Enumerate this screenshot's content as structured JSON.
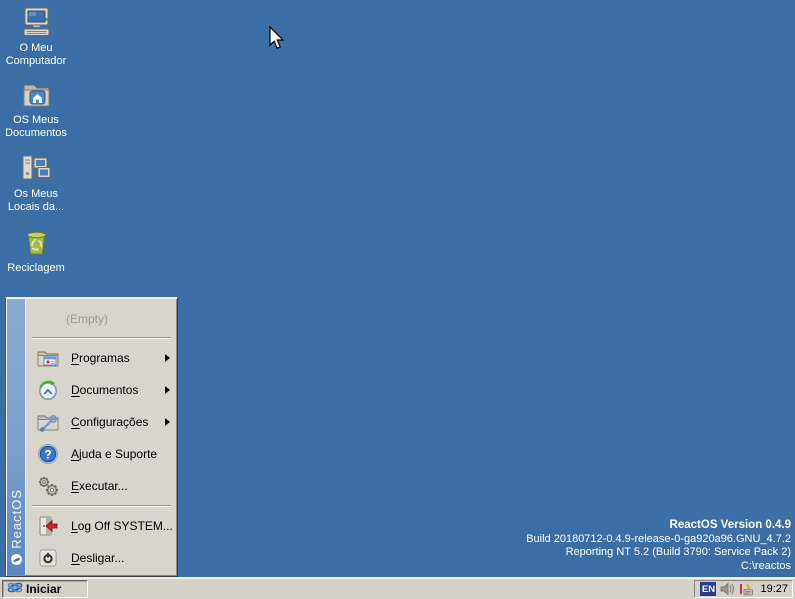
{
  "desktop": {
    "background_color": "#3B6EA5",
    "icons": [
      {
        "id": "my-computer",
        "lines": [
          "O Meu",
          "Computador"
        ]
      },
      {
        "id": "my-documents",
        "lines": [
          "OS Meus",
          "Documentos"
        ]
      },
      {
        "id": "network-places",
        "lines": [
          "Os Meus",
          "Locais da..."
        ]
      },
      {
        "id": "recycle-bin",
        "lines": [
          "Reciclagem"
        ]
      }
    ]
  },
  "start_menu": {
    "sidebar_text": "ReactOS",
    "empty_label": "(Empty)",
    "items": [
      {
        "id": "programas",
        "label": "Programas",
        "label_u": "P",
        "label_rest": "rogramas",
        "has_submenu": true
      },
      {
        "id": "documentos",
        "label": "Documentos",
        "label_u": "D",
        "label_rest": "ocumentos",
        "has_submenu": true
      },
      {
        "id": "configuracoes",
        "label": "Configurações",
        "label_u": "C",
        "label_rest": "onfigurações",
        "has_submenu": true
      },
      {
        "id": "ajuda",
        "label": "Ajuda e Suporte",
        "label_u": "A",
        "label_rest": "juda e Suporte",
        "has_submenu": false
      },
      {
        "id": "executar",
        "label": "Executar...",
        "label_u": "E",
        "label_rest": "xecutar...",
        "has_submenu": false
      },
      {
        "id": "logoff",
        "label": "Log Off SYSTEM...",
        "label_u": "L",
        "label_rest": "og Off SYSTEM...",
        "has_submenu": false
      },
      {
        "id": "desligar",
        "label": "Desligar...",
        "label_u": "D",
        "label_rest": "esligar...",
        "has_submenu": false
      }
    ]
  },
  "version_info": {
    "lines": [
      "ReactOS Version 0.4.9",
      "Build 20180712-0.4.9-release-0-ga920a96.GNU_4.7.2",
      "Reporting NT 5.2 (Build 3790: Service Pack 2)",
      "C:\\reactos"
    ]
  },
  "taskbar": {
    "start_label": "Iniciar",
    "tray": {
      "language_indicator": "EN",
      "clock": "19:27"
    }
  },
  "colors": {
    "desktop": "#3B6EA5",
    "menu_face": "#D8D5CD",
    "taskbar": "#D4D1C9",
    "sidebar_top": "#8AA9D2",
    "sidebar_bottom": "#5C86BE",
    "language_badge": "#2B3C90"
  }
}
